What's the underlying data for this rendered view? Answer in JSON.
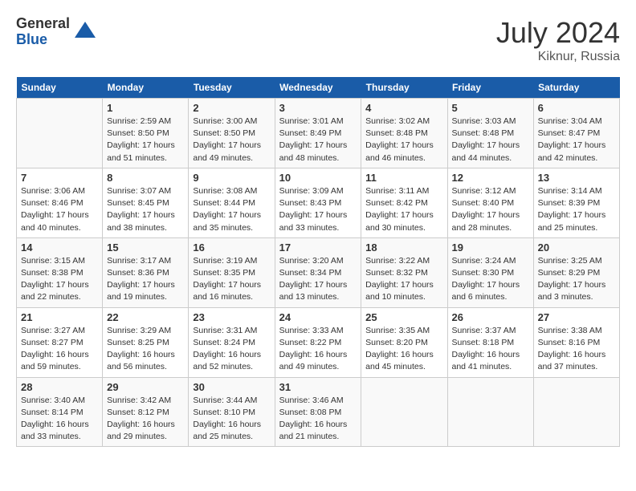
{
  "header": {
    "logo_general": "General",
    "logo_blue": "Blue",
    "title": "July 2024",
    "location": "Kiknur, Russia"
  },
  "days_of_week": [
    "Sunday",
    "Monday",
    "Tuesday",
    "Wednesday",
    "Thursday",
    "Friday",
    "Saturday"
  ],
  "weeks": [
    [
      {
        "day": "",
        "sunrise": "",
        "sunset": "",
        "daylight": ""
      },
      {
        "day": "1",
        "sunrise": "Sunrise: 2:59 AM",
        "sunset": "Sunset: 8:50 PM",
        "daylight": "Daylight: 17 hours and 51 minutes."
      },
      {
        "day": "2",
        "sunrise": "Sunrise: 3:00 AM",
        "sunset": "Sunset: 8:50 PM",
        "daylight": "Daylight: 17 hours and 49 minutes."
      },
      {
        "day": "3",
        "sunrise": "Sunrise: 3:01 AM",
        "sunset": "Sunset: 8:49 PM",
        "daylight": "Daylight: 17 hours and 48 minutes."
      },
      {
        "day": "4",
        "sunrise": "Sunrise: 3:02 AM",
        "sunset": "Sunset: 8:48 PM",
        "daylight": "Daylight: 17 hours and 46 minutes."
      },
      {
        "day": "5",
        "sunrise": "Sunrise: 3:03 AM",
        "sunset": "Sunset: 8:48 PM",
        "daylight": "Daylight: 17 hours and 44 minutes."
      },
      {
        "day": "6",
        "sunrise": "Sunrise: 3:04 AM",
        "sunset": "Sunset: 8:47 PM",
        "daylight": "Daylight: 17 hours and 42 minutes."
      }
    ],
    [
      {
        "day": "7",
        "sunrise": "Sunrise: 3:06 AM",
        "sunset": "Sunset: 8:46 PM",
        "daylight": "Daylight: 17 hours and 40 minutes."
      },
      {
        "day": "8",
        "sunrise": "Sunrise: 3:07 AM",
        "sunset": "Sunset: 8:45 PM",
        "daylight": "Daylight: 17 hours and 38 minutes."
      },
      {
        "day": "9",
        "sunrise": "Sunrise: 3:08 AM",
        "sunset": "Sunset: 8:44 PM",
        "daylight": "Daylight: 17 hours and 35 minutes."
      },
      {
        "day": "10",
        "sunrise": "Sunrise: 3:09 AM",
        "sunset": "Sunset: 8:43 PM",
        "daylight": "Daylight: 17 hours and 33 minutes."
      },
      {
        "day": "11",
        "sunrise": "Sunrise: 3:11 AM",
        "sunset": "Sunset: 8:42 PM",
        "daylight": "Daylight: 17 hours and 30 minutes."
      },
      {
        "day": "12",
        "sunrise": "Sunrise: 3:12 AM",
        "sunset": "Sunset: 8:40 PM",
        "daylight": "Daylight: 17 hours and 28 minutes."
      },
      {
        "day": "13",
        "sunrise": "Sunrise: 3:14 AM",
        "sunset": "Sunset: 8:39 PM",
        "daylight": "Daylight: 17 hours and 25 minutes."
      }
    ],
    [
      {
        "day": "14",
        "sunrise": "Sunrise: 3:15 AM",
        "sunset": "Sunset: 8:38 PM",
        "daylight": "Daylight: 17 hours and 22 minutes."
      },
      {
        "day": "15",
        "sunrise": "Sunrise: 3:17 AM",
        "sunset": "Sunset: 8:36 PM",
        "daylight": "Daylight: 17 hours and 19 minutes."
      },
      {
        "day": "16",
        "sunrise": "Sunrise: 3:19 AM",
        "sunset": "Sunset: 8:35 PM",
        "daylight": "Daylight: 17 hours and 16 minutes."
      },
      {
        "day": "17",
        "sunrise": "Sunrise: 3:20 AM",
        "sunset": "Sunset: 8:34 PM",
        "daylight": "Daylight: 17 hours and 13 minutes."
      },
      {
        "day": "18",
        "sunrise": "Sunrise: 3:22 AM",
        "sunset": "Sunset: 8:32 PM",
        "daylight": "Daylight: 17 hours and 10 minutes."
      },
      {
        "day": "19",
        "sunrise": "Sunrise: 3:24 AM",
        "sunset": "Sunset: 8:30 PM",
        "daylight": "Daylight: 17 hours and 6 minutes."
      },
      {
        "day": "20",
        "sunrise": "Sunrise: 3:25 AM",
        "sunset": "Sunset: 8:29 PM",
        "daylight": "Daylight: 17 hours and 3 minutes."
      }
    ],
    [
      {
        "day": "21",
        "sunrise": "Sunrise: 3:27 AM",
        "sunset": "Sunset: 8:27 PM",
        "daylight": "Daylight: 16 hours and 59 minutes."
      },
      {
        "day": "22",
        "sunrise": "Sunrise: 3:29 AM",
        "sunset": "Sunset: 8:25 PM",
        "daylight": "Daylight: 16 hours and 56 minutes."
      },
      {
        "day": "23",
        "sunrise": "Sunrise: 3:31 AM",
        "sunset": "Sunset: 8:24 PM",
        "daylight": "Daylight: 16 hours and 52 minutes."
      },
      {
        "day": "24",
        "sunrise": "Sunrise: 3:33 AM",
        "sunset": "Sunset: 8:22 PM",
        "daylight": "Daylight: 16 hours and 49 minutes."
      },
      {
        "day": "25",
        "sunrise": "Sunrise: 3:35 AM",
        "sunset": "Sunset: 8:20 PM",
        "daylight": "Daylight: 16 hours and 45 minutes."
      },
      {
        "day": "26",
        "sunrise": "Sunrise: 3:37 AM",
        "sunset": "Sunset: 8:18 PM",
        "daylight": "Daylight: 16 hours and 41 minutes."
      },
      {
        "day": "27",
        "sunrise": "Sunrise: 3:38 AM",
        "sunset": "Sunset: 8:16 PM",
        "daylight": "Daylight: 16 hours and 37 minutes."
      }
    ],
    [
      {
        "day": "28",
        "sunrise": "Sunrise: 3:40 AM",
        "sunset": "Sunset: 8:14 PM",
        "daylight": "Daylight: 16 hours and 33 minutes."
      },
      {
        "day": "29",
        "sunrise": "Sunrise: 3:42 AM",
        "sunset": "Sunset: 8:12 PM",
        "daylight": "Daylight: 16 hours and 29 minutes."
      },
      {
        "day": "30",
        "sunrise": "Sunrise: 3:44 AM",
        "sunset": "Sunset: 8:10 PM",
        "daylight": "Daylight: 16 hours and 25 minutes."
      },
      {
        "day": "31",
        "sunrise": "Sunrise: 3:46 AM",
        "sunset": "Sunset: 8:08 PM",
        "daylight": "Daylight: 16 hours and 21 minutes."
      },
      {
        "day": "",
        "sunrise": "",
        "sunset": "",
        "daylight": ""
      },
      {
        "day": "",
        "sunrise": "",
        "sunset": "",
        "daylight": ""
      },
      {
        "day": "",
        "sunrise": "",
        "sunset": "",
        "daylight": ""
      }
    ]
  ]
}
